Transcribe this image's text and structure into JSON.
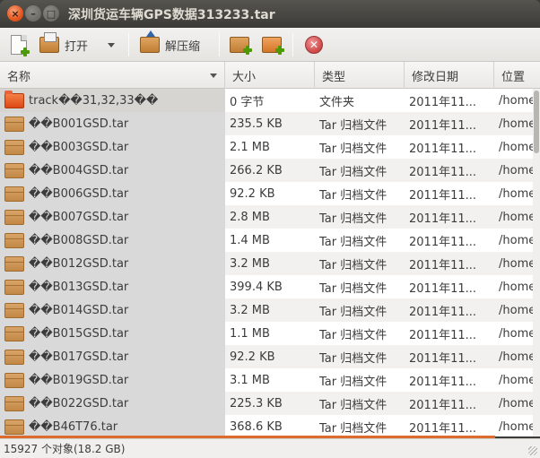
{
  "window": {
    "title": "深圳货运车辆GPS数据313233.tar",
    "close_glyph": "×",
    "min_glyph": "–",
    "max_glyph": "□"
  },
  "toolbar": {
    "new_icon": "new-archive-icon",
    "open_label": "打开",
    "extract_label": "解压缩",
    "add_files_icon": "add-files-icon",
    "add_folder_icon": "add-folder-icon",
    "stop_icon": "stop-icon",
    "stop_glyph": "✕"
  },
  "columns": [
    {
      "label": "名称"
    },
    {
      "label": "大小"
    },
    {
      "label": "类型"
    },
    {
      "label": "修改日期"
    },
    {
      "label": "位置"
    }
  ],
  "rows": [
    {
      "name": "track��31,32,33��",
      "size": "0 字节",
      "type": "文件夹",
      "date": "2011年11...",
      "location": "/home/",
      "icon": "folder"
    },
    {
      "name": "��B001GSD.tar",
      "size": "235.5 KB",
      "type": "Tar 归档文件",
      "date": "2011年11...",
      "location": "/home/",
      "icon": "archive"
    },
    {
      "name": "��B003GSD.tar",
      "size": "2.1 MB",
      "type": "Tar 归档文件",
      "date": "2011年11...",
      "location": "/home/",
      "icon": "archive"
    },
    {
      "name": "��B004GSD.tar",
      "size": "266.2 KB",
      "type": "Tar 归档文件",
      "date": "2011年11...",
      "location": "/home/",
      "icon": "archive"
    },
    {
      "name": "��B006GSD.tar",
      "size": "92.2 KB",
      "type": "Tar 归档文件",
      "date": "2011年11...",
      "location": "/home/",
      "icon": "archive"
    },
    {
      "name": "��B007GSD.tar",
      "size": "2.8 MB",
      "type": "Tar 归档文件",
      "date": "2011年11...",
      "location": "/home/",
      "icon": "archive"
    },
    {
      "name": "��B008GSD.tar",
      "size": "1.4 MB",
      "type": "Tar 归档文件",
      "date": "2011年11...",
      "location": "/home/",
      "icon": "archive"
    },
    {
      "name": "��B012GSD.tar",
      "size": "3.2 MB",
      "type": "Tar 归档文件",
      "date": "2011年11...",
      "location": "/home/",
      "icon": "archive"
    },
    {
      "name": "��B013GSD.tar",
      "size": "399.4 KB",
      "type": "Tar 归档文件",
      "date": "2011年11...",
      "location": "/home/",
      "icon": "archive"
    },
    {
      "name": "��B014GSD.tar",
      "size": "3.2 MB",
      "type": "Tar 归档文件",
      "date": "2011年11...",
      "location": "/home/",
      "icon": "archive"
    },
    {
      "name": "��B015GSD.tar",
      "size": "1.1 MB",
      "type": "Tar 归档文件",
      "date": "2011年11...",
      "location": "/home/",
      "icon": "archive"
    },
    {
      "name": "��B017GSD.tar",
      "size": "92.2 KB",
      "type": "Tar 归档文件",
      "date": "2011年11...",
      "location": "/home/",
      "icon": "archive"
    },
    {
      "name": "��B019GSD.tar",
      "size": "3.1 MB",
      "type": "Tar 归档文件",
      "date": "2011年11...",
      "location": "/home/",
      "icon": "archive"
    },
    {
      "name": "��B022GSD.tar",
      "size": "225.3 KB",
      "type": "Tar 归档文件",
      "date": "2011年11...",
      "location": "/home/",
      "icon": "archive"
    },
    {
      "name": "��B46T76.tar",
      "size": "368.6 KB",
      "type": "Tar 归档文件",
      "date": "2011年11...",
      "location": "/home/",
      "icon": "archive"
    }
  ],
  "status": {
    "text": "15927 个对象(18.2 GB)"
  },
  "colors": {
    "accent": "#dd4814",
    "progress": "#dd6b2e",
    "titlebar": "#3c3b37"
  }
}
